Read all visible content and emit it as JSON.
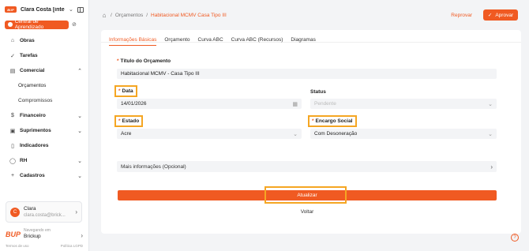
{
  "sidebar": {
    "logo_text": "BUP",
    "user_short": "Clara Costa [inter...",
    "learning_button": "Central de Aprendizado",
    "nav": [
      {
        "label": "Obras",
        "icon": "building-icon"
      },
      {
        "label": "Tarefas",
        "icon": "check-circle-icon"
      },
      {
        "label": "Comercial",
        "icon": "briefcase-icon"
      },
      {
        "label": "Orçamentos",
        "sub": true
      },
      {
        "label": "Compromissos",
        "sub": true
      },
      {
        "label": "Financeiro",
        "icon": "dollar-icon"
      },
      {
        "label": "Suprimentos",
        "icon": "cart-icon"
      },
      {
        "label": "Indicadores",
        "icon": "bar-chart-icon"
      },
      {
        "label": "RH",
        "icon": "person-icon"
      },
      {
        "label": "Cadastros",
        "icon": "plus-icon"
      }
    ],
    "user_card": {
      "initial": "C",
      "name": "Clara",
      "email": "clara.costa@brick..."
    },
    "footer": {
      "label": "Navegando em",
      "company": "Brickup",
      "terms": "Termos de uso",
      "privacy": "Política LGPD"
    }
  },
  "header": {
    "breadcrumb": [
      "Orçamentos",
      "Habitacional MCMV Casa Tipo III"
    ],
    "reject_label": "Reprovar",
    "approve_label": "Aprovar"
  },
  "tabs": [
    "Informações Básicas",
    "Orçamento",
    "Curva ABC",
    "Curva ABC (Recursos)",
    "Diagramas"
  ],
  "form": {
    "title_label": "Título do Orçamento",
    "title_value": "Habitacional MCMV - Casa Tipo III",
    "date_label": "Data",
    "date_value": "14/01/2026",
    "status_label": "Status",
    "status_value": "Pendente",
    "state_label": "Estado",
    "state_value": "Acre",
    "charges_label": "Encargo Social",
    "charges_value": "Com Desoneração",
    "more_info": "Mais informações (Opcional)",
    "update_button": "Atualizar",
    "back_button": "Voltar"
  },
  "colors": {
    "accent": "#f05a22",
    "highlight": "#f5a623"
  }
}
